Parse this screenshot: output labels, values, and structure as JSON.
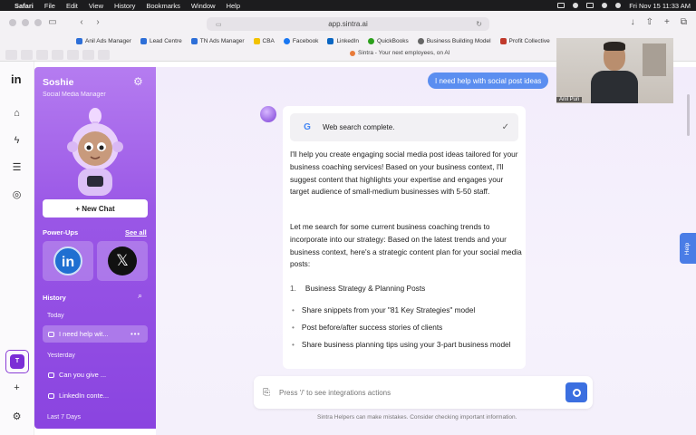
{
  "menubar": {
    "app": "Safari",
    "items": [
      "File",
      "Edit",
      "View",
      "History",
      "Bookmarks",
      "Window",
      "Help"
    ],
    "datetime": "Fri Nov 15  11:33 AM"
  },
  "browser": {
    "url": "app.sintra.ai",
    "bookmarks": [
      {
        "label": "Anil Ads Manager",
        "color": "#2d6fd8"
      },
      {
        "label": "Lead Centre",
        "color": "#2d6fd8"
      },
      {
        "label": "TN Ads Manager",
        "color": "#2d6fd8"
      },
      {
        "label": "CBA",
        "color": "#f2c200"
      },
      {
        "label": "Facebook",
        "color": "#1877f2"
      },
      {
        "label": "LinkedIn",
        "color": "#0a66c2"
      },
      {
        "label": "QuickBooks",
        "color": "#2ca01c"
      },
      {
        "label": "Business Building Model",
        "color": "#666666"
      },
      {
        "label": "Profit Collective",
        "color": "#c0392b"
      }
    ],
    "active_tab_title": "Sintra - Your next employees, on AI"
  },
  "sidebar": {
    "name": "Soshie",
    "role": "Social Media Manager",
    "new_chat": "+ New Chat",
    "powerups_label": "Power-Ups",
    "see_all": "See all",
    "history_label": "History",
    "groups": {
      "today": "Today",
      "yesterday": "Yesterday",
      "last7": "Last 7 Days"
    },
    "today_items": [
      "I need help wit..."
    ],
    "yesterday_items": [
      "Can you give ...",
      "LinkedIn conte..."
    ]
  },
  "chat": {
    "user_message": "I need help with social post ideas",
    "web_search_status": "Web search complete.",
    "para1": "I'll help you create engaging social media post ideas tailored for your business coaching services! Based on your business context, I'll suggest content that highlights your expertise and engages your target audience of small-medium businesses with 5-50 staff.",
    "para2": "Let me search for some current business coaching trends to incorporate into our strategy: Based on the latest trends and your business context, here's a strategic content plan for your social media posts:",
    "list_item_1_num": "1.",
    "list_item_1": "Business Strategy & Planning Posts",
    "bullets": [
      "Share snippets from your \"81 Key Strategies\" model",
      "Post before/after success stories of clients",
      "Share business planning tips using your 3-part business model"
    ],
    "input_placeholder": "Press '/' to see integrations actions",
    "disclaimer": "Sintra Helpers can make mistakes. Consider checking important information.",
    "help_tab": "Help"
  },
  "webcam": {
    "name": "Anil Puri"
  },
  "colors": {
    "accent_purple": "#8a44e0",
    "user_bubble": "#5b8ef0",
    "send_button": "#3b6fe0"
  }
}
